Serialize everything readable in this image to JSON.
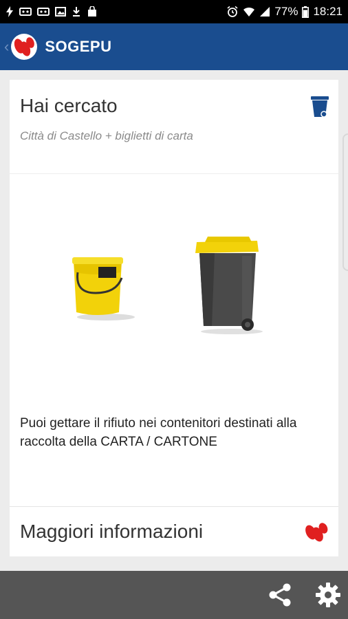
{
  "status_bar": {
    "battery": "77%",
    "time": "18:21"
  },
  "app_bar": {
    "title": "SOGEPU"
  },
  "search_card": {
    "title": "Hai cercato",
    "query": "Città di Castello + biglietti di carta",
    "disposal_text": "Puoi gettare il rifiuto nei contenitori destinati alla raccolta della CARTA / CARTONE"
  },
  "more_card": {
    "title": "Maggiori informazioni"
  },
  "colors": {
    "app_bar": "#1a4d8f",
    "brand_red": "#e02020",
    "bin_yellow": "#f2d20a",
    "bin_gray": "#4a4a4a",
    "bottom_bar": "#555555"
  },
  "icons": {
    "top_right": "trash-bin-icon",
    "more_info": "sogepu-logo-icon",
    "bottom_left": "share-icon",
    "bottom_right": "gear-icon"
  }
}
